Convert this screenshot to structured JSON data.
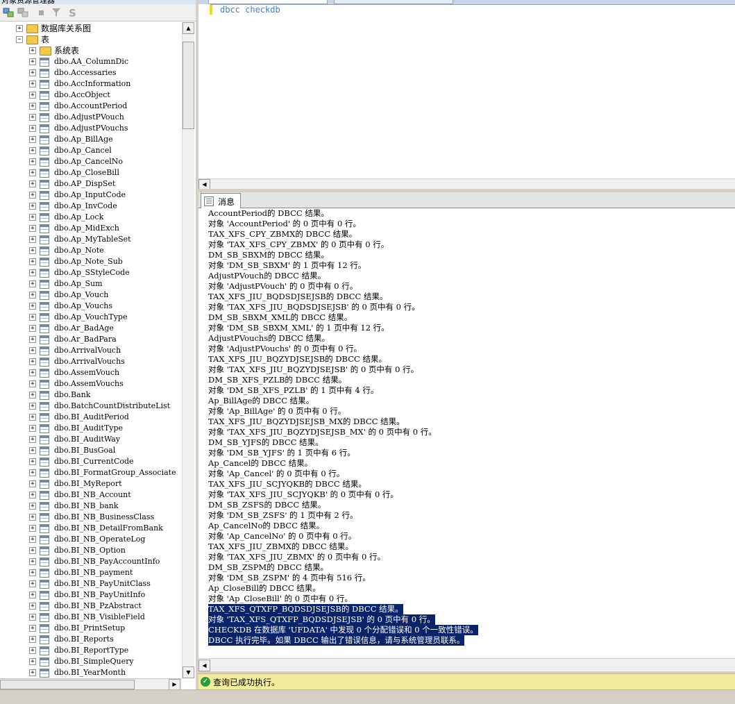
{
  "left_panel": {
    "title": "对象资源管理器",
    "toolbar_icons": [
      "connect-icon",
      "disconnect-icon",
      "stop-icon",
      "filter-icon",
      "refresh-icon"
    ],
    "tree": [
      {
        "label": "数据库关系图",
        "icon": "folder-icon",
        "expander": "+",
        "level": 0,
        "cn": true
      },
      {
        "label": "表",
        "icon": "folder-icon",
        "expander": "−",
        "level": 0,
        "cn": true
      },
      {
        "label": "系统表",
        "icon": "folder-icon",
        "expander": "+",
        "level": 1,
        "cn": true
      },
      {
        "label": "dbo.AA_ColumnDic",
        "icon": "table-icon",
        "expander": "+",
        "level": 1
      },
      {
        "label": "dbo.Accessaries",
        "icon": "table-icon",
        "expander": "+",
        "level": 1
      },
      {
        "label": "dbo.AccInformation",
        "icon": "table-icon",
        "expander": "+",
        "level": 1
      },
      {
        "label": "dbo.AccObject",
        "icon": "table-icon",
        "expander": "+",
        "level": 1
      },
      {
        "label": "dbo.AccountPeriod",
        "icon": "table-icon",
        "expander": "+",
        "level": 1
      },
      {
        "label": "dbo.AdjustPVouch",
        "icon": "table-icon",
        "expander": "+",
        "level": 1
      },
      {
        "label": "dbo.AdjustPVouchs",
        "icon": "table-icon",
        "expander": "+",
        "level": 1
      },
      {
        "label": "dbo.Ap_BillAge",
        "icon": "table-icon",
        "expander": "+",
        "level": 1
      },
      {
        "label": "dbo.Ap_Cancel",
        "icon": "table-icon",
        "expander": "+",
        "level": 1
      },
      {
        "label": "dbo.Ap_CancelNo",
        "icon": "table-icon",
        "expander": "+",
        "level": 1
      },
      {
        "label": "dbo.Ap_CloseBill",
        "icon": "table-icon",
        "expander": "+",
        "level": 1
      },
      {
        "label": "dbo.AP_DispSet",
        "icon": "table-icon",
        "expander": "+",
        "level": 1
      },
      {
        "label": "dbo.Ap_InputCode",
        "icon": "table-icon",
        "expander": "+",
        "level": 1
      },
      {
        "label": "dbo.Ap_InvCode",
        "icon": "table-icon",
        "expander": "+",
        "level": 1
      },
      {
        "label": "dbo.Ap_Lock",
        "icon": "table-icon",
        "expander": "+",
        "level": 1
      },
      {
        "label": "dbo.Ap_MidExch",
        "icon": "table-icon",
        "expander": "+",
        "level": 1
      },
      {
        "label": "dbo.Ap_MyTableSet",
        "icon": "table-icon",
        "expander": "+",
        "level": 1
      },
      {
        "label": "dbo.Ap_Note",
        "icon": "table-icon",
        "expander": "+",
        "level": 1
      },
      {
        "label": "dbo.Ap_Note_Sub",
        "icon": "table-icon",
        "expander": "+",
        "level": 1
      },
      {
        "label": "dbo.Ap_SStyleCode",
        "icon": "table-icon",
        "expander": "+",
        "level": 1
      },
      {
        "label": "dbo.Ap_Sum",
        "icon": "table-icon",
        "expander": "+",
        "level": 1
      },
      {
        "label": "dbo.Ap_Vouch",
        "icon": "table-icon",
        "expander": "+",
        "level": 1
      },
      {
        "label": "dbo.Ap_Vouchs",
        "icon": "table-icon",
        "expander": "+",
        "level": 1
      },
      {
        "label": "dbo.Ap_VouchType",
        "icon": "table-icon",
        "expander": "+",
        "level": 1
      },
      {
        "label": "dbo.Ar_BadAge",
        "icon": "table-icon",
        "expander": "+",
        "level": 1
      },
      {
        "label": "dbo.Ar_BadPara",
        "icon": "table-icon",
        "expander": "+",
        "level": 1
      },
      {
        "label": "dbo.ArrivalVouch",
        "icon": "table-icon",
        "expander": "+",
        "level": 1
      },
      {
        "label": "dbo.ArrivalVouchs",
        "icon": "table-icon",
        "expander": "+",
        "level": 1
      },
      {
        "label": "dbo.AssemVouch",
        "icon": "table-icon",
        "expander": "+",
        "level": 1
      },
      {
        "label": "dbo.AssemVouchs",
        "icon": "table-icon",
        "expander": "+",
        "level": 1
      },
      {
        "label": "dbo.Bank",
        "icon": "table-icon",
        "expander": "+",
        "level": 1
      },
      {
        "label": "dbo.BatchCountDistributeList",
        "icon": "table-icon",
        "expander": "+",
        "level": 1
      },
      {
        "label": "dbo.BI_AuditPeriod",
        "icon": "table-icon",
        "expander": "+",
        "level": 1
      },
      {
        "label": "dbo.BI_AuditType",
        "icon": "table-icon",
        "expander": "+",
        "level": 1
      },
      {
        "label": "dbo.BI_AuditWay",
        "icon": "table-icon",
        "expander": "+",
        "level": 1
      },
      {
        "label": "dbo.BI_BusGoal",
        "icon": "table-icon",
        "expander": "+",
        "level": 1
      },
      {
        "label": "dbo.BI_CurrentCode",
        "icon": "table-icon",
        "expander": "+",
        "level": 1
      },
      {
        "label": "dbo.BI_FormatGroup_Associate",
        "icon": "table-icon",
        "expander": "+",
        "level": 1
      },
      {
        "label": "dbo.BI_MyReport",
        "icon": "table-icon",
        "expander": "+",
        "level": 1
      },
      {
        "label": "dbo.BI_NB_Account",
        "icon": "table-icon",
        "expander": "+",
        "level": 1
      },
      {
        "label": "dbo.BI_NB_bank",
        "icon": "table-icon",
        "expander": "+",
        "level": 1
      },
      {
        "label": "dbo.BI_NB_BusinessClass",
        "icon": "table-icon",
        "expander": "+",
        "level": 1
      },
      {
        "label": "dbo.BI_NB_DetailFromBank",
        "icon": "table-icon",
        "expander": "+",
        "level": 1
      },
      {
        "label": "dbo.BI_NB_OperateLog",
        "icon": "table-icon",
        "expander": "+",
        "level": 1
      },
      {
        "label": "dbo.BI_NB_Option",
        "icon": "table-icon",
        "expander": "+",
        "level": 1
      },
      {
        "label": "dbo.BI_NB_PayAccountInfo",
        "icon": "table-icon",
        "expander": "+",
        "level": 1
      },
      {
        "label": "dbo.BI_NB_payment",
        "icon": "table-icon",
        "expander": "+",
        "level": 1
      },
      {
        "label": "dbo.BI_NB_PayUnitClass",
        "icon": "table-icon",
        "expander": "+",
        "level": 1
      },
      {
        "label": "dbo.BI_NB_PayUnitInfo",
        "icon": "table-icon",
        "expander": "+",
        "level": 1
      },
      {
        "label": "dbo.BI_NB_PzAbstract",
        "icon": "table-icon",
        "expander": "+",
        "level": 1
      },
      {
        "label": "dbo.BI_NB_VisibleField",
        "icon": "table-icon",
        "expander": "+",
        "level": 1
      },
      {
        "label": "dbo.BI_PrintSetup",
        "icon": "table-icon",
        "expander": "+",
        "level": 1
      },
      {
        "label": "dbo.BI_Reports",
        "icon": "table-icon",
        "expander": "+",
        "level": 1
      },
      {
        "label": "dbo.BI_ReportType",
        "icon": "table-icon",
        "expander": "+",
        "level": 1
      },
      {
        "label": "dbo.BI_SimpleQuery",
        "icon": "table-icon",
        "expander": "+",
        "level": 1
      },
      {
        "label": "dbo.BI_YearMonth",
        "icon": "table-icon",
        "expander": "+",
        "level": 1
      }
    ]
  },
  "editor": {
    "code": "dbcc checkdb"
  },
  "results": {
    "tab_label": "消息",
    "lines": [
      {
        "text": "AccountPeriod的 DBCC 结果。",
        "selected": false
      },
      {
        "text": "对象 'AccountPeriod' 的 0 页中有 0 行。",
        "selected": false
      },
      {
        "text": "TAX_XFS_CPY_ZBMX的 DBCC 结果。",
        "selected": false
      },
      {
        "text": "对象 'TAX_XFS_CPY_ZBMX' 的 0 页中有 0 行。",
        "selected": false
      },
      {
        "text": "DM_SB_SBXM的 DBCC 结果。",
        "selected": false
      },
      {
        "text": "对象 'DM_SB_SBXM' 的 1 页中有 12 行。",
        "selected": false
      },
      {
        "text": "AdjustPVouch的 DBCC 结果。",
        "selected": false
      },
      {
        "text": "对象 'AdjustPVouch' 的 0 页中有 0 行。",
        "selected": false
      },
      {
        "text": "TAX_XFS_JIU_BQDSDJSEJSB的 DBCC 结果。",
        "selected": false
      },
      {
        "text": "对象 'TAX_XFS_JIU_BQDSDJSEJSB' 的 0 页中有 0 行。",
        "selected": false
      },
      {
        "text": "DM_SB_SBXM_XML的 DBCC 结果。",
        "selected": false
      },
      {
        "text": "对象 'DM_SB_SBXM_XML' 的 1 页中有 12 行。",
        "selected": false
      },
      {
        "text": "AdjustPVouchs的 DBCC 结果。",
        "selected": false
      },
      {
        "text": "对象 'AdjustPVouchs' 的 0 页中有 0 行。",
        "selected": false
      },
      {
        "text": "TAX_XFS_JIU_BQZYDJSEJSB的 DBCC 结果。",
        "selected": false
      },
      {
        "text": "对象 'TAX_XFS_JIU_BQZYDJSEJSB' 的 0 页中有 0 行。",
        "selected": false
      },
      {
        "text": "DM_SB_XFS_PZLB的 DBCC 结果。",
        "selected": false
      },
      {
        "text": "对象 'DM_SB_XFS_PZLB' 的 1 页中有 4 行。",
        "selected": false
      },
      {
        "text": "Ap_BillAge的 DBCC 结果。",
        "selected": false
      },
      {
        "text": "对象 'Ap_BillAge' 的 0 页中有 0 行。",
        "selected": false
      },
      {
        "text": "TAX_XFS_JIU_BQZYDJSEJSB_MX的 DBCC 结果。",
        "selected": false
      },
      {
        "text": "对象 'TAX_XFS_JIU_BQZYDJSEJSB_MX' 的 0 页中有 0 行。",
        "selected": false
      },
      {
        "text": "DM_SB_YJFS的 DBCC 结果。",
        "selected": false
      },
      {
        "text": "对象 'DM_SB_YJFS' 的 1 页中有 6 行。",
        "selected": false
      },
      {
        "text": "Ap_Cancel的 DBCC 结果。",
        "selected": false
      },
      {
        "text": "对象 'Ap_Cancel' 的 0 页中有 0 行。",
        "selected": false
      },
      {
        "text": "TAX_XFS_JIU_SCJYQKB的 DBCC 结果。",
        "selected": false
      },
      {
        "text": "对象 'TAX_XFS_JIU_SCJYQKB' 的 0 页中有 0 行。",
        "selected": false
      },
      {
        "text": "DM_SB_ZSFS的 DBCC 结果。",
        "selected": false
      },
      {
        "text": "对象 'DM_SB_ZSFS' 的 1 页中有 2 行。",
        "selected": false
      },
      {
        "text": "Ap_CancelNo的 DBCC 结果。",
        "selected": false
      },
      {
        "text": "对象 'Ap_CancelNo' 的 0 页中有 0 行。",
        "selected": false
      },
      {
        "text": "TAX_XFS_JIU_ZBMX的 DBCC 结果。",
        "selected": false
      },
      {
        "text": "对象 'TAX_XFS_JIU_ZBMX' 的 0 页中有 0 行。",
        "selected": false
      },
      {
        "text": "DM_SB_ZSPM的 DBCC 结果。",
        "selected": false
      },
      {
        "text": "对象 'DM_SB_ZSPM' 的 4 页中有 516 行。",
        "selected": false
      },
      {
        "text": "Ap_CloseBill的 DBCC 结果。",
        "selected": false
      },
      {
        "text": "对象 'Ap_CloseBill' 的 0 页中有 0 行。",
        "selected": false
      },
      {
        "text": "TAX_XFS_QTXFP_BQDSDJSEJSB的 DBCC 结果。",
        "selected": true
      },
      {
        "text": "对象 'TAX_XFS_QTXFP_BQDSDJSEJSB' 的 0 页中有 0 行。",
        "selected": true
      },
      {
        "text": "CHECKDB 在数据库 'UFDATA' 中发现 0 个分配错误和 0 个一致性错误。",
        "selected": true
      },
      {
        "text": "DBCC 执行完毕。如果 DBCC 输出了错误信息，请与系统管理员联系。",
        "selected": true
      }
    ]
  },
  "status": {
    "text": "查询已成功执行。",
    "icon": "success-check-icon"
  },
  "colors": {
    "selection": "#0a246a",
    "status_bar": "#f2ec9c",
    "keyword": "#3d7fc8",
    "change_bar": "#f0e000"
  }
}
